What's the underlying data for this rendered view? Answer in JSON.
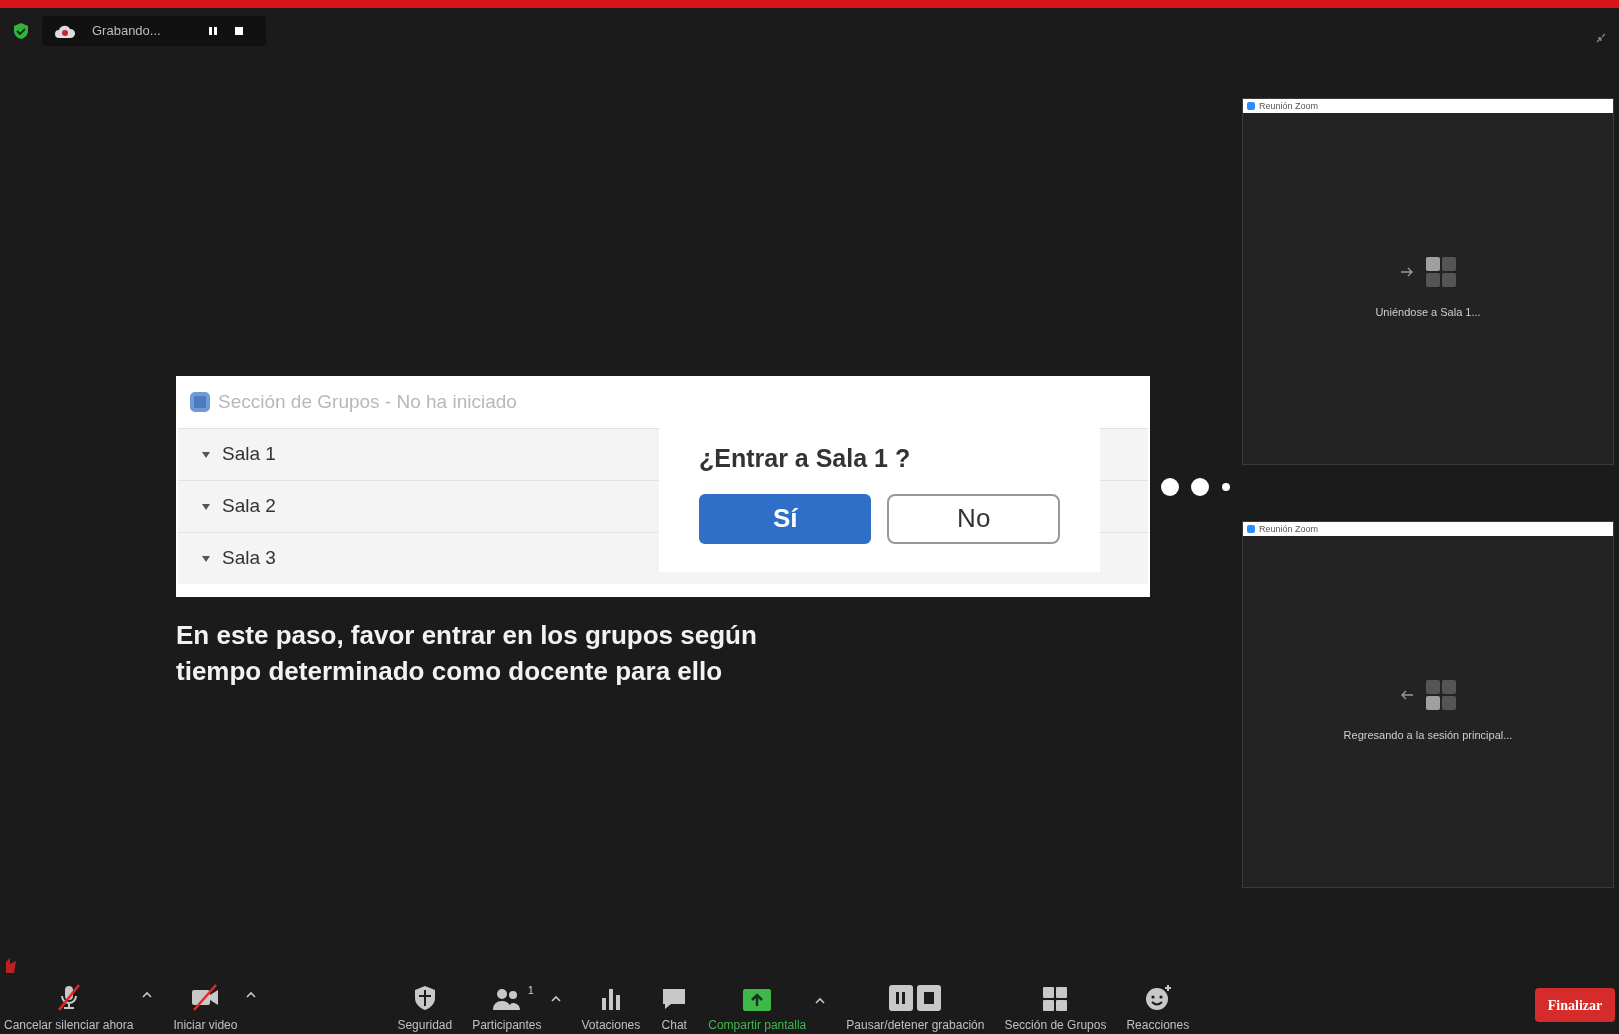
{
  "recording_bar": {
    "status": "Grabando..."
  },
  "breakout_dialog": {
    "title": "Sección de Grupos - No ha iniciado",
    "rooms": [
      {
        "name": "Sala 1"
      },
      {
        "name": "Sala 2"
      },
      {
        "name": "Sala 3"
      }
    ],
    "prompt": {
      "question": "¿Entrar a Sala 1 ?",
      "buttons": [
        {
          "label": "Sí",
          "kind": "primary"
        },
        {
          "label": "No",
          "kind": "secondary"
        }
      ]
    }
  },
  "caption": "En este paso, favor entrar en los grupos según tiempo determinado como docente para ello",
  "mini_windows": [
    {
      "title": "Reunión Zoom",
      "message": "Uniéndose a Sala 1...",
      "kind": "joining"
    },
    {
      "title": "Reunión Zoom",
      "message": "Regresando a la sesión principal...",
      "kind": "returning"
    }
  ],
  "toolbar": {
    "items": [
      {
        "kind": "mic",
        "label": "Cancelar silenciar ahora",
        "has_menu": true
      },
      {
        "kind": "video",
        "label": "Iniciar video",
        "has_menu": true
      },
      {
        "kind": "security",
        "label": "Seguridad",
        "has_menu": false
      },
      {
        "kind": "participants",
        "label": "Participantes",
        "count": "1",
        "has_menu": true
      },
      {
        "kind": "polls",
        "label": "Votaciones",
        "has_menu": false
      },
      {
        "kind": "chat",
        "label": "Chat",
        "has_menu": false
      },
      {
        "kind": "share",
        "label": "Compartir pantalla",
        "has_menu": true
      },
      {
        "kind": "record",
        "label": "Pausar/detener grabación",
        "has_menu": false
      },
      {
        "kind": "breakout",
        "label": "Sección de Grupos",
        "has_menu": false
      },
      {
        "kind": "reactions",
        "label": "Reacciones",
        "has_menu": false
      }
    ],
    "end_button": "Finalizar"
  }
}
